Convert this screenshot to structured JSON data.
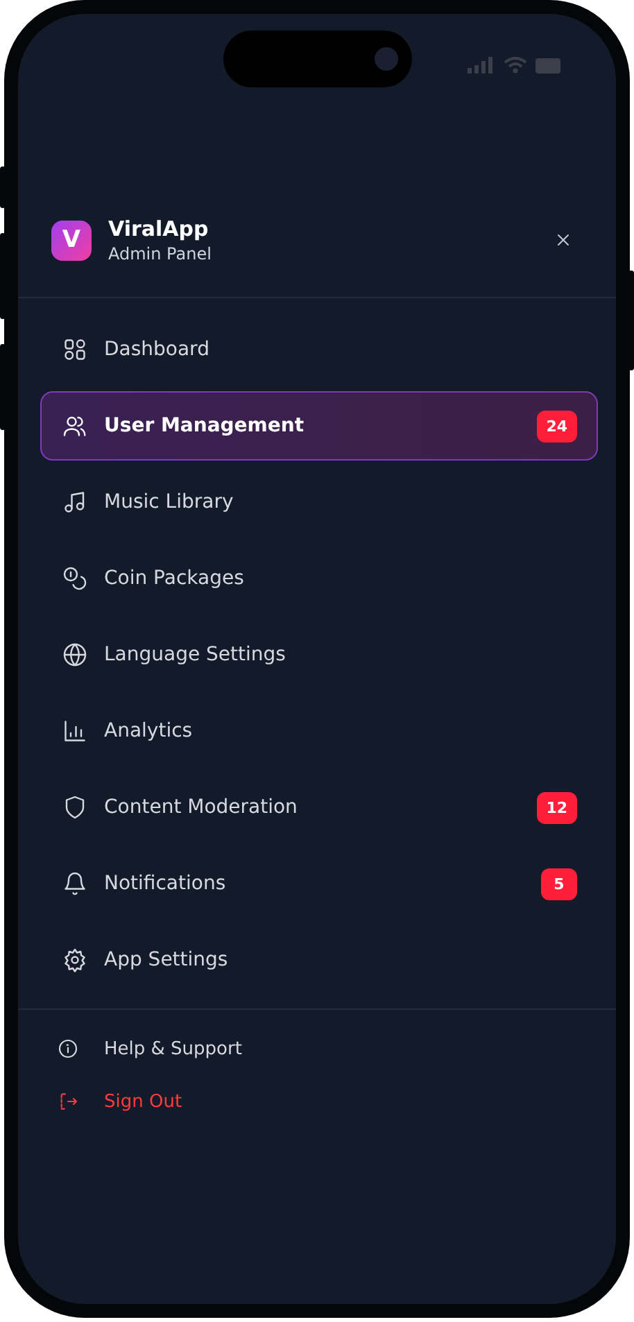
{
  "header": {
    "logo_letter": "V",
    "title": "ViralApp",
    "subtitle": "Admin Panel"
  },
  "nav_items": [
    {
      "label": "Dashboard",
      "selected": false
    },
    {
      "label": "User Management",
      "selected": true,
      "badge": "24"
    },
    {
      "label": "Music Library",
      "selected": false
    },
    {
      "label": "Coin Packages",
      "selected": false
    },
    {
      "label": "Language Settings",
      "selected": false
    },
    {
      "label": "Analytics",
      "selected": false
    },
    {
      "label": "Content Moderation",
      "selected": false,
      "badge": "12"
    },
    {
      "label": "Notifications",
      "selected": false,
      "badge": "5"
    },
    {
      "label": "App Settings",
      "selected": false
    }
  ],
  "footer_items": [
    {
      "label": "Help & Support",
      "kind": "normal"
    },
    {
      "label": "Sign Out",
      "kind": "danger"
    }
  ]
}
